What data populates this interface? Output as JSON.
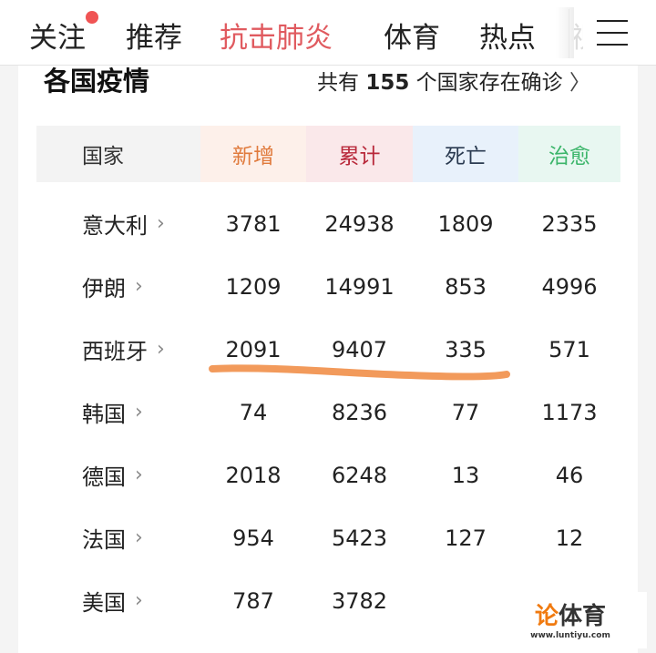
{
  "nav": {
    "tabs": [
      {
        "label": "关注"
      },
      {
        "label": "推荐"
      },
      {
        "label": "抗击肺炎",
        "active": true
      },
      {
        "label": "体育"
      },
      {
        "label": "热点"
      }
    ],
    "ghost": "视",
    "accent": "#e05a5f"
  },
  "section": {
    "title": "各国疫情",
    "summary_prefix": "共有",
    "summary_count": "155",
    "summary_suffix": "个国家存在确诊"
  },
  "table": {
    "headers": [
      "国家",
      "新增",
      "累计",
      "死亡",
      "治愈"
    ],
    "header_colors": [
      "#333333",
      "#e07a3c",
      "#b8283a",
      "#2a3a50",
      "#3bb56a"
    ],
    "header_bgs": [
      "#f3f3f3",
      "#fdf0ea",
      "#fae8ea",
      "#e8f1fb",
      "#e8f7f1"
    ],
    "rows": [
      [
        "意大利",
        "3781",
        "24938",
        "1809",
        "2335"
      ],
      [
        "伊朗",
        "1209",
        "14991",
        "853",
        "4996"
      ],
      [
        "西班牙",
        "2091",
        "9407",
        "335",
        "571"
      ],
      [
        "韩国",
        "74",
        "8236",
        "77",
        "1173"
      ],
      [
        "德国",
        "2018",
        "6248",
        "13",
        "46"
      ],
      [
        "法国",
        "954",
        "5423",
        "127",
        "12"
      ],
      [
        "美国",
        "787",
        "3782",
        "",
        ""
      ]
    ],
    "highlight_color": "#f0883e"
  },
  "watermark": {
    "brand_a": "论",
    "brand_b": "体育",
    "url": "www.luntiyu.com"
  }
}
